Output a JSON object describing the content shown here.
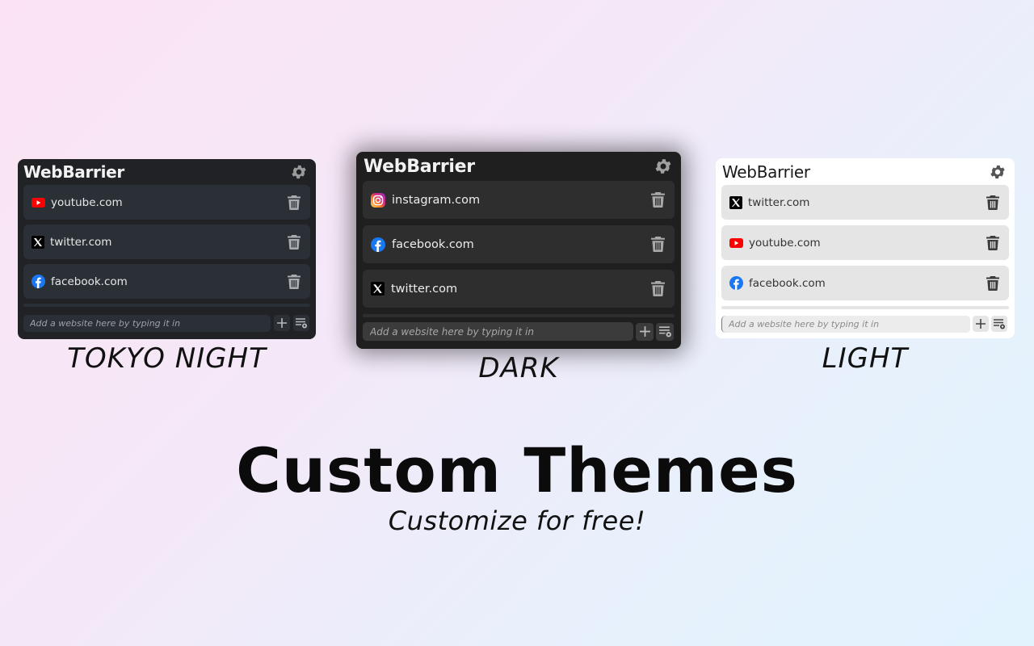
{
  "cards": [
    {
      "theme_label": "TOKYO NIGHT",
      "brand": "WebBarrier",
      "sites": [
        {
          "label": "youtube.com",
          "icon": "youtube-icon"
        },
        {
          "label": "twitter.com",
          "icon": "x-twitter-icon"
        },
        {
          "label": "facebook.com",
          "icon": "facebook-icon"
        }
      ],
      "input_placeholder": "Add a website here by typing it in",
      "colors": {
        "background": "#202226",
        "row": "#2b2f36",
        "text": "#e8e8e8"
      }
    },
    {
      "theme_label": "DARK",
      "brand": "WebBarrier",
      "sites": [
        {
          "label": "instagram.com",
          "icon": "instagram-icon"
        },
        {
          "label": "facebook.com",
          "icon": "facebook-icon"
        },
        {
          "label": "twitter.com",
          "icon": "x-twitter-icon"
        }
      ],
      "input_placeholder": "Add a website here by typing it in",
      "colors": {
        "background": "#1f1f1f",
        "row": "#2e2e2e",
        "text": "#ececec"
      }
    },
    {
      "theme_label": "LIGHT",
      "brand": "WebBarrier",
      "sites": [
        {
          "label": "twitter.com",
          "icon": "x-twitter-icon"
        },
        {
          "label": "youtube.com",
          "icon": "youtube-icon"
        },
        {
          "label": "facebook.com",
          "icon": "facebook-icon"
        }
      ],
      "input_placeholder": "Add a website here by typing it in",
      "colors": {
        "background": "#ffffff",
        "row": "#e5e5e5",
        "text": "#333333"
      }
    }
  ],
  "headline": "Custom Themes",
  "subline": "Customize for free!"
}
